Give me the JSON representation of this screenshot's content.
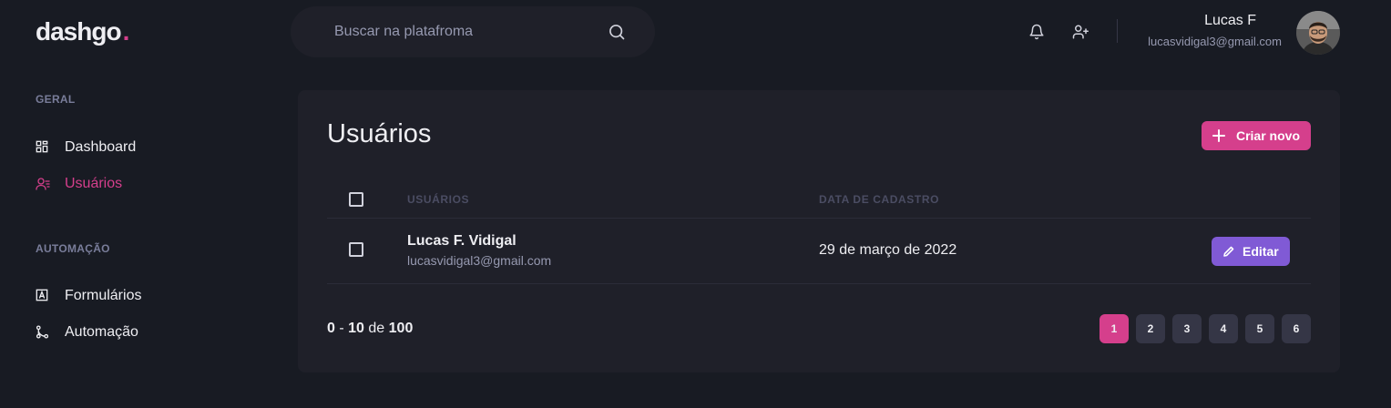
{
  "logo": {
    "text": "dashgo",
    "dot": "."
  },
  "search": {
    "placeholder": "Buscar na platafroma",
    "value": ""
  },
  "user": {
    "name": "Lucas F",
    "email": "lucasvidigal3@gmail.com"
  },
  "sidebar": {
    "sections": [
      {
        "title": "GERAL",
        "items": [
          {
            "label": "Dashboard",
            "icon": "dashboard-icon"
          },
          {
            "label": "Usuários",
            "icon": "users-icon",
            "active": true
          }
        ]
      },
      {
        "title": "AUTOMAÇÃO",
        "items": [
          {
            "label": "Formulários",
            "icon": "form-icon"
          },
          {
            "label": "Automação",
            "icon": "git-merge-icon"
          }
        ]
      }
    ]
  },
  "main": {
    "title": "Usuários",
    "create_button": "Criar novo",
    "table": {
      "headers": [
        "USUÁRIOS",
        "DATA DE CADASTRO"
      ],
      "rows": [
        {
          "name": "Lucas F. Vidigal",
          "email": "lucasvidigal3@gmail.com",
          "date": "29 de março de 2022",
          "edit_label": "Editar"
        }
      ]
    },
    "pagination": {
      "from": "0",
      "sep": "-",
      "to": "10",
      "of": "de",
      "total": "100",
      "pages": [
        "1",
        "2",
        "3",
        "4",
        "5",
        "6"
      ],
      "current": "1"
    }
  },
  "colors": {
    "background": "#181b23",
    "surface": "#1f2029",
    "accent": "#d53f8c",
    "edit": "#805ad5"
  }
}
